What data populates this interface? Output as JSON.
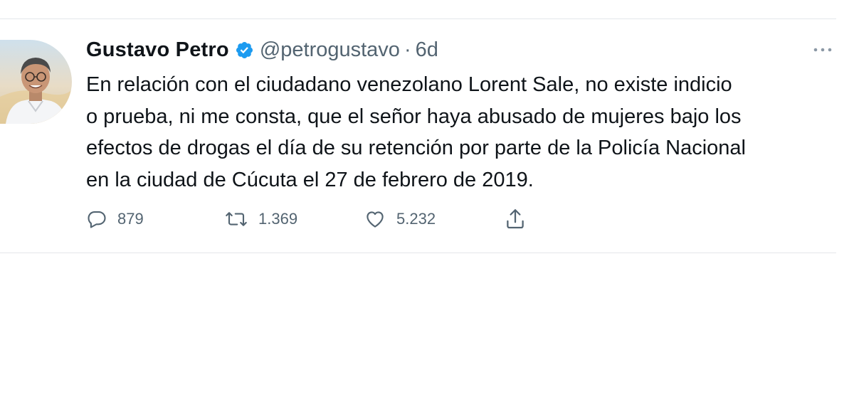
{
  "tweet": {
    "author_name": "Gustavo Petro",
    "handle": "@petrogustavo",
    "separator": "·",
    "time": "6d",
    "verified_icon": "verified-badge-icon",
    "text": "En relación con el ciudadano venezolano Lorent Sale, no existe indicio\no prueba, ni me consta, que el señor haya abusado de mujeres bajo los\nefectos de drogas el día de su retención por parte de la Policía Nacional\nen la ciudad de Cúcuta el 27 de febrero de 2019.",
    "actions": {
      "replies": "879",
      "retweets": "1.369",
      "likes": "5.232"
    }
  },
  "colors": {
    "text_primary": "#0f1419",
    "text_secondary": "#536471",
    "verified_blue": "#1d9bf0",
    "divider": "#e4e7ea"
  },
  "icons": {
    "reply": "reply-icon",
    "retweet": "retweet-icon",
    "like": "heart-icon",
    "share": "share-icon",
    "more": "more-icon"
  }
}
